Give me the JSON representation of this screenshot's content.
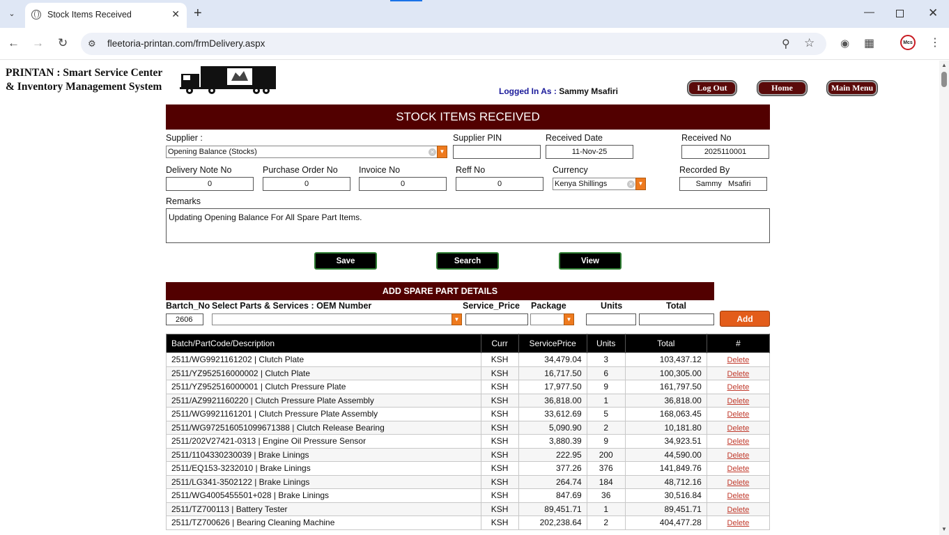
{
  "browser": {
    "tab_title": "Stock Items Received",
    "url": "fleetoria-printan.com/frmDelivery.aspx",
    "profile_initials": "Mcs"
  },
  "header": {
    "brand_line1": "PRINTAN : Smart Service Center",
    "brand_line2": "& Inventory Management System",
    "logged_label": "Logged In As :",
    "logged_user": "Sammy Msafiri",
    "logout": "Log Out",
    "home": "Home",
    "main_menu": "Main Menu"
  },
  "form": {
    "title": "STOCK ITEMS RECEIVED",
    "supplier_label": "Supplier :",
    "supplier_value": "Opening Balance (Stocks)",
    "supplier_pin_label": "Supplier PIN",
    "supplier_pin_value": "",
    "received_date_label": "Received Date",
    "received_date_value": "11-Nov-25",
    "received_no_label": "Received No",
    "received_no_value": "2025110001",
    "delivery_note_label": "Delivery Note No",
    "delivery_note_value": "0",
    "po_label": "Purchase Order No",
    "po_value": "0",
    "invoice_label": "Invoice No",
    "invoice_value": "0",
    "reff_label": "Reff No",
    "reff_value": "0",
    "currency_label": "Currency",
    "currency_value": "Kenya Shillings",
    "recorded_by_label": "Recorded By",
    "recorded_by_value": "Sammy   Msafiri",
    "remarks_label": "Remarks",
    "remarks_value": "Updating Opening Balance For All Spare Part Items.",
    "save": "Save",
    "search": "Search",
    "view": "View"
  },
  "spare": {
    "title": "ADD SPARE PART DETAILS",
    "batch_label": "Bartch_No",
    "parts_label": "Select Parts & Services : OEM Number",
    "price_label": "Service_Price",
    "package_label": "Package",
    "units_label": "Units",
    "total_label": "Total",
    "batch_value": "2606",
    "add": "Add"
  },
  "grid": {
    "headers": [
      "Batch/PartCode/Description",
      "Curr",
      "ServicePrice",
      "Units",
      "Total",
      "#"
    ],
    "delete_label": "Delete",
    "rows": [
      {
        "desc": "2511/WG9921161202 | Clutch Plate",
        "curr": "KSH",
        "price": "34,479.04",
        "units": "3",
        "total": "103,437.12"
      },
      {
        "desc": "2511/YZ952516000002 | Clutch Plate",
        "curr": "KSH",
        "price": "16,717.50",
        "units": "6",
        "total": "100,305.00"
      },
      {
        "desc": "2511/YZ952516000001 | Clutch Pressure Plate",
        "curr": "KSH",
        "price": "17,977.50",
        "units": "9",
        "total": "161,797.50"
      },
      {
        "desc": "2511/AZ9921160220 | Clutch Pressure Plate Assembly",
        "curr": "KSH",
        "price": "36,818.00",
        "units": "1",
        "total": "36,818.00"
      },
      {
        "desc": "2511/WG9921161201 | Clutch Pressure Plate Assembly",
        "curr": "KSH",
        "price": "33,612.69",
        "units": "5",
        "total": "168,063.45"
      },
      {
        "desc": "2511/WG972516051099671388 | Clutch Release Bearing",
        "curr": "KSH",
        "price": "5,090.90",
        "units": "2",
        "total": "10,181.80"
      },
      {
        "desc": "2511/202V27421-0313 | Engine Oil Pressure Sensor",
        "curr": "KSH",
        "price": "3,880.39",
        "units": "9",
        "total": "34,923.51"
      },
      {
        "desc": "2511/1104330230039 | Brake Linings",
        "curr": "KSH",
        "price": "222.95",
        "units": "200",
        "total": "44,590.00"
      },
      {
        "desc": "2511/EQ153-3232010 | Brake Linings",
        "curr": "KSH",
        "price": "377.26",
        "units": "376",
        "total": "141,849.76"
      },
      {
        "desc": "2511/LG341-3502122 | Brake Linings",
        "curr": "KSH",
        "price": "264.74",
        "units": "184",
        "total": "48,712.16"
      },
      {
        "desc": "2511/WG4005455501+028 | Brake Linings",
        "curr": "KSH",
        "price": "847.69",
        "units": "36",
        "total": "30,516.84"
      },
      {
        "desc": "2511/TZ700113 | Battery Tester",
        "curr": "KSH",
        "price": "89,451.71",
        "units": "1",
        "total": "89,451.71"
      },
      {
        "desc": "2511/TZ700626 | Bearing Cleaning Machine",
        "curr": "KSH",
        "price": "202,238.64",
        "units": "2",
        "total": "404,477.28"
      }
    ]
  }
}
